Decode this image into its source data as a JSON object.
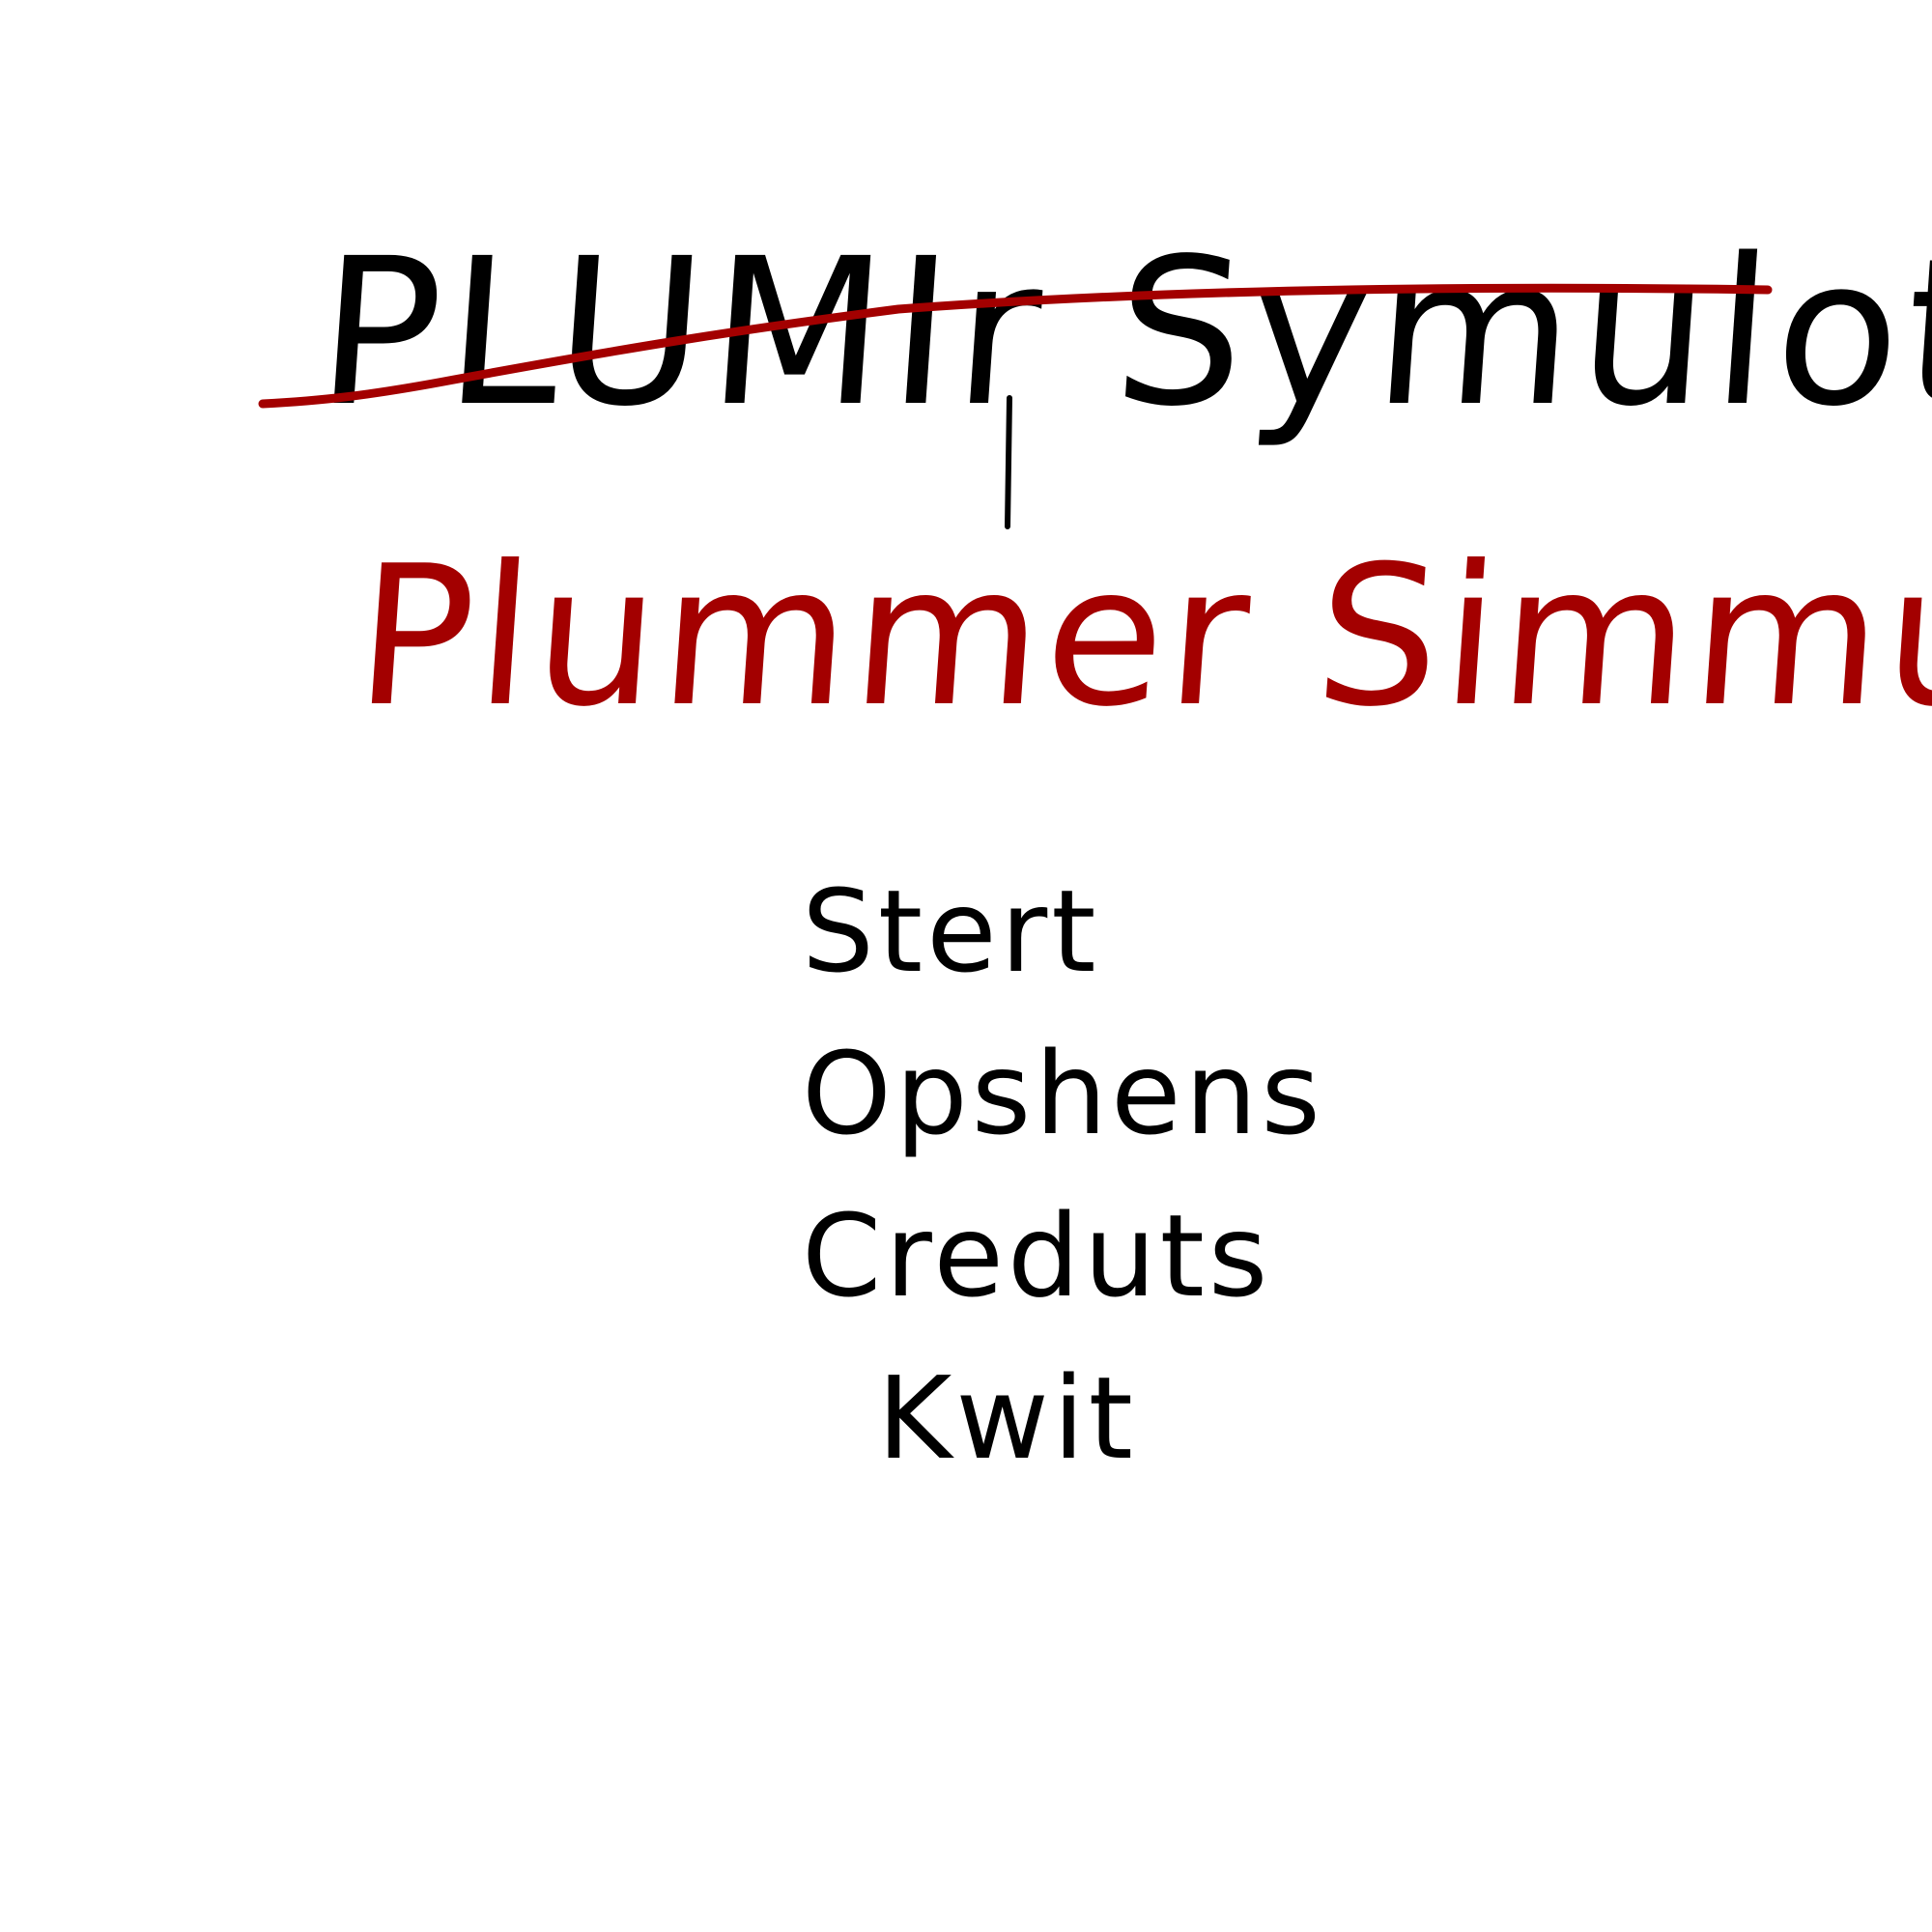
{
  "title": {
    "crossed_out": "PLUMIr Symulotor",
    "corrected": "Plummer Simmulater",
    "strike_color": "#a30000",
    "corrected_color": "#a30000",
    "ink_color": "#000000"
  },
  "menu": {
    "items": [
      {
        "id": "start",
        "label": "Stert"
      },
      {
        "id": "options",
        "label": "Opshens"
      },
      {
        "id": "credits",
        "label": "Creduts"
      },
      {
        "id": "quit",
        "label": "Kwit"
      }
    ]
  }
}
